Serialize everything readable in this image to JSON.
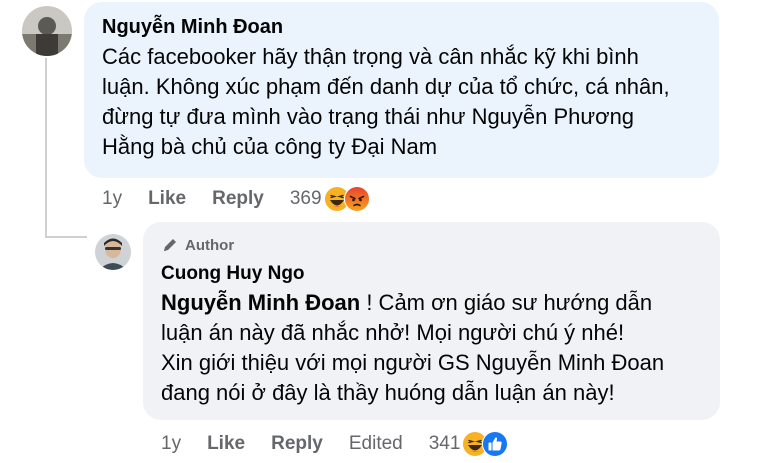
{
  "comments": [
    {
      "author": "Nguyễn Minh Đoan",
      "lines": [
        "Các facebooker hãy thận trọng và cân nhắc kỹ khi bình",
        "luận. Không xúc phạm đến danh dự của tổ chức, cá nhân,",
        "đừng tự đưa mình vào trạng thái như Nguyễn Phương",
        "Hằng bà chủ của công ty Đại Nam"
      ],
      "time": "1y",
      "like_label": "Like",
      "reply_label": "Reply",
      "reaction_count": "369",
      "reactions": [
        "haha-icon",
        "angry-icon"
      ]
    },
    {
      "badge": "Author",
      "author": "Cuong Huy Ngo",
      "mention": "Nguyễn Minh Đoan",
      "line1_rest": " ! Cảm ơn giáo sư hướng dẫn",
      "lines": [
        "luận án này đã nhắc nhở! Mọi người chú ý nhé!",
        "Xin giới thiệu với mọi người GS Nguyễn Minh Đoan",
        "đang nói ở đây là thầy huóng dẫn luận án này!"
      ],
      "time": "1y",
      "like_label": "Like",
      "reply_label": "Reply",
      "edited_label": "Edited",
      "reaction_count": "341",
      "reactions": [
        "haha-icon",
        "like-icon"
      ]
    }
  ],
  "colors": {
    "bubble_highlight": "#ebf3fd",
    "bubble": "#f0f2f5",
    "meta_text": "#65676b",
    "like_blue": "#1877f2",
    "emoji_yellow": "#f7b125",
    "angry_red": "#e9710f"
  }
}
